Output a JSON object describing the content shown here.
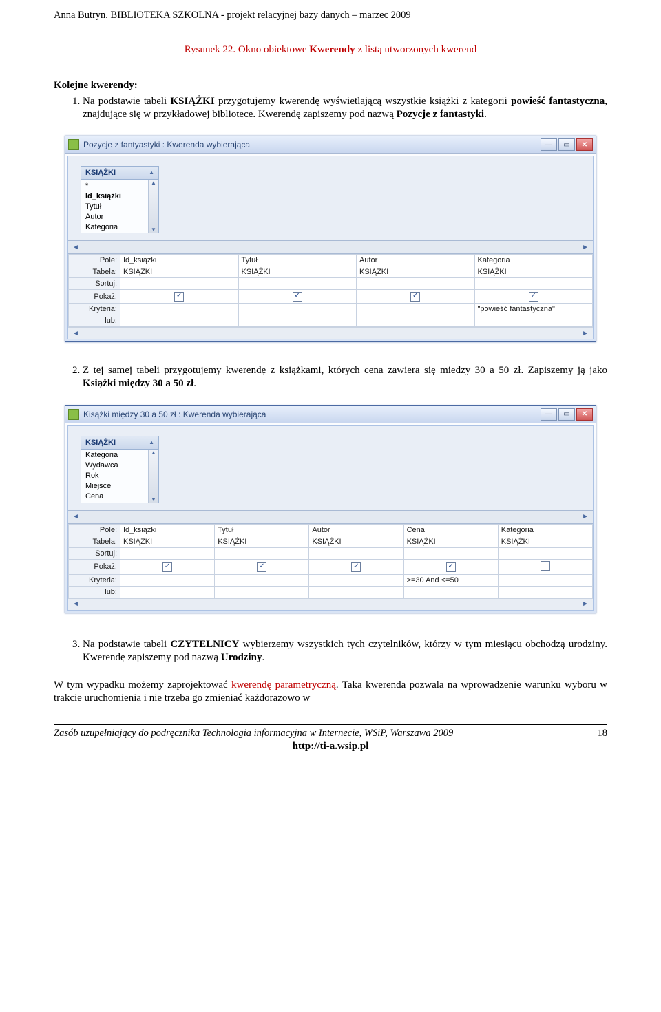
{
  "header": {
    "text": "Anna Butryn. BIBLIOTEKA SZKOLNA  - projekt relacyjnej bazy danych –  marzec 2009"
  },
  "caption": {
    "prefix": "Rysunek 22. Okno obiektowe ",
    "bold": "Kwerendy",
    "suffix": " z listą utworzonych kwerend"
  },
  "intro": {
    "kicker": "Kolejne kwerendy:"
  },
  "items": {
    "one": {
      "p1": "Na podstawie tabeli ",
      "b1": "KSIĄŻKI",
      "p2": " przygotujemy kwerendę wyświetlającą wszystkie książki z kategorii ",
      "b2": "powieść fantastyczna",
      "p3": ", znajdujące się w przykładowej bibliotece. Kwerendę zapiszemy pod nazwą ",
      "b3": "Pozycje z fantastyki",
      "p4": "."
    },
    "two": {
      "p1": "Z tej samej tabeli przygotujemy kwerendę z książkami, których cena zawiera się miedzy 30 a 50 zł. Zapiszemy ją jako ",
      "b1": "Książki między 30 a 50 zł",
      "p2": "."
    },
    "three": {
      "p1": "Na podstawie tabeli ",
      "b1": "CZYTELNICY",
      "p2": " wybierzemy wszystkich tych czytelników, którzy w tym miesiącu obchodzą urodziny. Kwerendę zapiszemy pod nazwą ",
      "b2": "Urodziny",
      "p3": "."
    }
  },
  "tail": {
    "p1": "W tym wypadku możemy zaprojektować ",
    "kw": "kwerendę parametryczną",
    "p2": ". Taka kwerenda pozwala na wprowadzenie warunku wyboru w trakcie uruchomienia i nie trzeba go zmieniać każdorazowo w"
  },
  "win1": {
    "title": "Pozycje z fantyastyki : Kwerenda wybierająca",
    "table": "KSIĄŻKI",
    "fields": {
      "star": "*",
      "f0": "Id_książki",
      "f1": "Tytuł",
      "f2": "Autor",
      "f3": "Kategoria"
    },
    "rows": {
      "pole": "Pole:",
      "tabela": "Tabela:",
      "sortuj": "Sortuj:",
      "pokaz": "Pokaż:",
      "kryteria": "Kryteria:",
      "lub": "lub:"
    },
    "cols": {
      "c1": {
        "pole": "Id_książki",
        "tabela": "KSIĄŻKI",
        "chk": true,
        "kryt": ""
      },
      "c2": {
        "pole": "Tytuł",
        "tabela": "KSIĄŻKI",
        "chk": true,
        "kryt": ""
      },
      "c3": {
        "pole": "Autor",
        "tabela": "KSIĄŻKI",
        "chk": true,
        "kryt": ""
      },
      "c4": {
        "pole": "Kategoria",
        "tabela": "KSIĄŻKI",
        "chk": true,
        "kryt": "\"powieść fantastyczna\""
      }
    }
  },
  "win2": {
    "title": "Kisążki między 30 a 50 zł : Kwerenda wybierająca",
    "table": "KSIĄŻKI",
    "fields": {
      "f0": "Kategoria",
      "f1": "Wydawca",
      "f2": "Rok",
      "f3": "Miejsce",
      "f4": "Cena"
    },
    "rows": {
      "pole": "Pole:",
      "tabela": "Tabela:",
      "sortuj": "Sortuj:",
      "pokaz": "Pokaż:",
      "kryteria": "Kryteria:",
      "lub": "lub:"
    },
    "cols": {
      "c1": {
        "pole": "Id_książki",
        "tabela": "KSIĄŻKI",
        "chk": true,
        "kryt": ""
      },
      "c2": {
        "pole": "Tytuł",
        "tabela": "KSIĄŻKI",
        "chk": true,
        "kryt": ""
      },
      "c3": {
        "pole": "Autor",
        "tabela": "KSIĄŻKI",
        "chk": true,
        "kryt": ""
      },
      "c4": {
        "pole": "Cena",
        "tabela": "KSIĄŻKI",
        "chk": true,
        "kryt": ">=30 And <=50"
      },
      "c5": {
        "pole": "Kategoria",
        "tabela": "KSIĄŻKI",
        "chk": false,
        "kryt": ""
      }
    }
  },
  "footer": {
    "left": "Zasób uzupełniający do podręcznika Technologia informacyjna w Internecie, WSiP, Warszawa 2009",
    "page": "18",
    "url": "http://ti-a.wsip.pl"
  }
}
